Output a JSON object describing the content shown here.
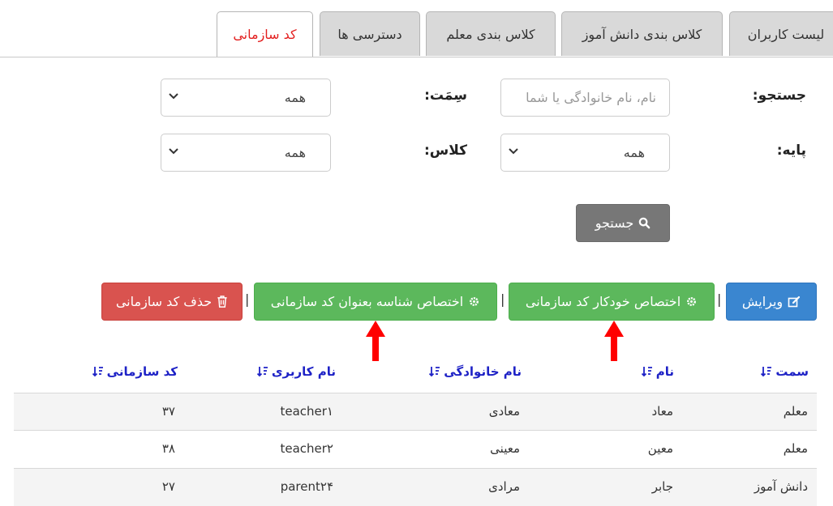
{
  "tabs": [
    {
      "label": "لیست کاربران"
    },
    {
      "label": "کلاس بندی دانش آموز"
    },
    {
      "label": "کلاس بندی معلم"
    },
    {
      "label": "دسترسی ها"
    },
    {
      "label": "کد سازمانی"
    }
  ],
  "active_tab": 4,
  "filters": {
    "search_label": "جستجو:",
    "search_placeholder": "نام، نام خانوادگی یا شما",
    "role_label": "سِمَت:",
    "role_value": "همه",
    "grade_label": "پایه:",
    "grade_value": "همه",
    "class_label": "کلاس:",
    "class_value": "همه"
  },
  "search_button": "جستجو",
  "actions": {
    "edit": "ویرایش",
    "auto_assign": "اختصاص خودکار کد سازمانی",
    "id_assign": "اختصاص شناسه بعنوان کد سازمانی",
    "delete": "حذف کد سازمانی",
    "separator": "|"
  },
  "table": {
    "columns": [
      "سمت",
      "نام",
      "نام خانوادگی",
      "نام کاربری",
      "کد سازمانی"
    ],
    "rows": [
      [
        "معلم",
        "معاد",
        "معادی",
        "teacher۱",
        "۳۷"
      ],
      [
        "معلم",
        "معین",
        "معینی",
        "teacher۲",
        "۳۸"
      ],
      [
        "دانش آموز",
        "جابر",
        "مرادی",
        "parent۲۴",
        "۲۷"
      ]
    ]
  },
  "colors": {
    "active_tab": "#e31f1f",
    "header_link": "#1e22c6",
    "arrow": "#ff0000"
  }
}
